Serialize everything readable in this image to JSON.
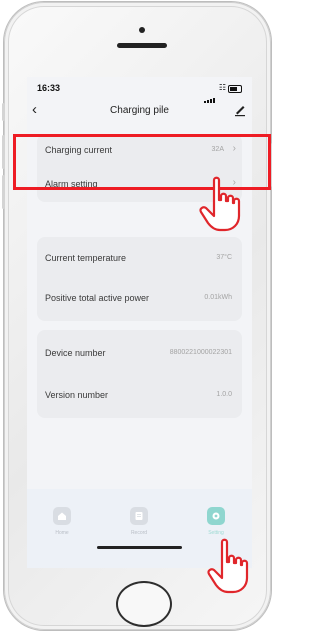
{
  "status_bar": {
    "time": "16:33"
  },
  "navbar": {
    "title": "Charging pile"
  },
  "groups": [
    {
      "rows": [
        {
          "label": "Charging current",
          "value": "32A"
        },
        {
          "label": "Alarm setting",
          "value": ""
        }
      ]
    },
    {
      "rows": [
        {
          "label": "Current temperature",
          "value": "37°C"
        },
        {
          "label": "Positive total active power",
          "value": "0.01kWh"
        }
      ]
    },
    {
      "rows": [
        {
          "label": "Device number",
          "value": "8800221000022301"
        },
        {
          "label": "Version number",
          "value": "1.0.0"
        }
      ]
    }
  ],
  "tabs": [
    {
      "label": "Home",
      "icon": "home-icon",
      "active": false
    },
    {
      "label": "Record",
      "icon": "record-icon",
      "active": false
    },
    {
      "label": "Setting",
      "icon": "gear-icon",
      "active": true
    }
  ],
  "colors": {
    "highlight": "#ee1c24",
    "accent": "#8fd6cf",
    "background": "#f3f4f7"
  },
  "annotations": [
    "red-highlight-box",
    "pointing-hand-icon",
    "pointing-hand-icon"
  ]
}
